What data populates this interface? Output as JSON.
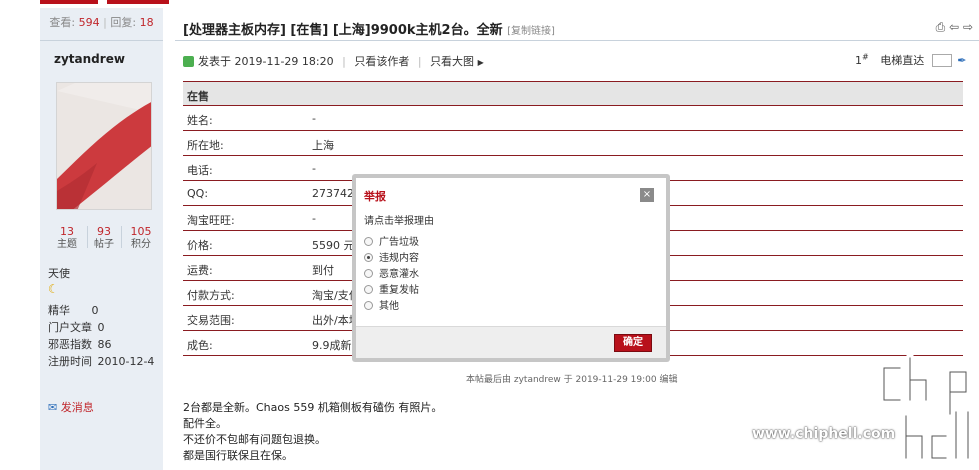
{
  "header": {
    "views_label": "查看:",
    "views": "594",
    "replies_label": "回复:",
    "replies": "18"
  },
  "thread": {
    "title": "[处理器主板内存] [在售] [上海]9900k主机2台。全新",
    "copy_link": "[复制链接]"
  },
  "author": {
    "name": "zytandrew",
    "stats": [
      {
        "value": "13",
        "label": "主题"
      },
      {
        "value": "93",
        "label": "帖子"
      },
      {
        "value": "105",
        "label": "积分"
      }
    ],
    "rank": "天使",
    "rank_icon": "moon-icon",
    "details": [
      {
        "label": "精华",
        "value": "0"
      },
      {
        "label": "门户文章",
        "value": "0"
      },
      {
        "label": "邪恶指数",
        "value": "86"
      },
      {
        "label": "注册时间",
        "value": "2010-12-4"
      }
    ],
    "send_message": "发消息"
  },
  "post": {
    "posted_at": "发表于 2019-11-29 18:20",
    "only_author": "只看该作者",
    "only_images": "只看大图",
    "floor": "1",
    "floor_sup": "#",
    "jump_label": "电梯直达",
    "edited_note": "本帖最后由 zytandrew 于 2019-11-29 19:00 编辑"
  },
  "trade": {
    "header": "在售",
    "rows": [
      {
        "key": "姓名:",
        "value": "-"
      },
      {
        "key": "所在地:",
        "value": "上海"
      },
      {
        "key": "电话:",
        "value": "-"
      },
      {
        "key": "QQ:",
        "value": "2737421"
      },
      {
        "key": "淘宝旺旺:",
        "value": "-"
      },
      {
        "key": "价格:",
        "value": "5590 元"
      },
      {
        "key": "运费:",
        "value": "到付"
      },
      {
        "key": "付款方式:",
        "value": "淘宝/支付"
      },
      {
        "key": "交易范围:",
        "value": "出外/本地"
      },
      {
        "key": "成色:",
        "value": "9.9成新,仅"
      }
    ]
  },
  "body_lines": [
    "2台都是全新。Chaos 559 机箱侧板有磕伤 有照片。",
    "配件全。",
    "不还价不包邮有问题包退换。",
    "都是国行联保且在保。"
  ],
  "report_dialog": {
    "title": "举报",
    "close": "×",
    "prompt": "请点击举报理由",
    "options": [
      {
        "label": "广告垃圾",
        "selected": false
      },
      {
        "label": "违规内容",
        "selected": true
      },
      {
        "label": "恶意灌水",
        "selected": false
      },
      {
        "label": "重复发帖",
        "selected": false
      },
      {
        "label": "其他",
        "selected": false
      }
    ],
    "confirm": "确定"
  },
  "watermark": {
    "url": "www.chiphell.com"
  },
  "colors": {
    "accent": "#b8111b",
    "sidebar_bg": "#e9eef4"
  }
}
